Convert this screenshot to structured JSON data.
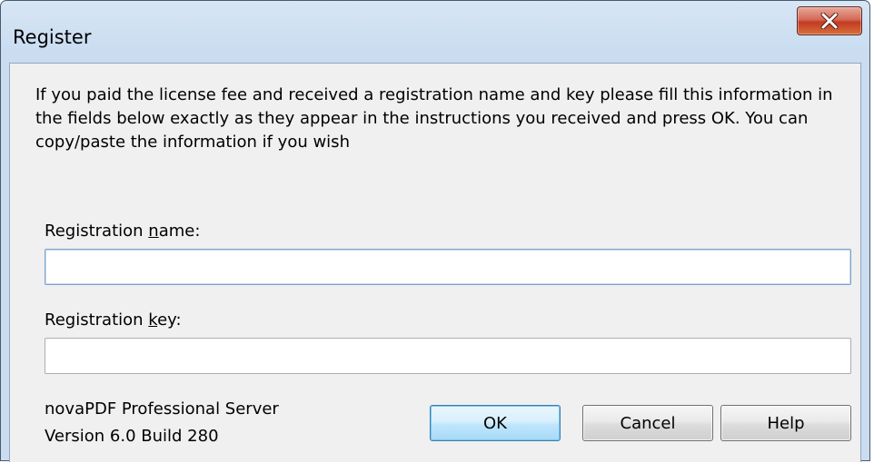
{
  "window": {
    "title": "Register"
  },
  "titlebar": {
    "close_icon": "close-icon"
  },
  "instructions": "If you paid the license fee and received a registration name and key please fill this information in the fields below exactly as they appear in the instructions you received and press OK. You can copy/paste the information if you wish",
  "fields": {
    "name": {
      "label_prefix": "Registration ",
      "label_accel": "n",
      "label_suffix": "ame:",
      "value": ""
    },
    "key": {
      "label_prefix": "Registration ",
      "label_accel": "k",
      "label_suffix": "ey:",
      "value": ""
    }
  },
  "product": {
    "name": "novaPDF Professional Server",
    "version": "Version 6.0 Build 280"
  },
  "buttons": {
    "ok": "OK",
    "cancel": "Cancel",
    "help": "Help"
  },
  "colors": {
    "close_button": "#c23a22",
    "default_button": "#a7d9f5",
    "focused_field_border": "#7da2ce"
  }
}
